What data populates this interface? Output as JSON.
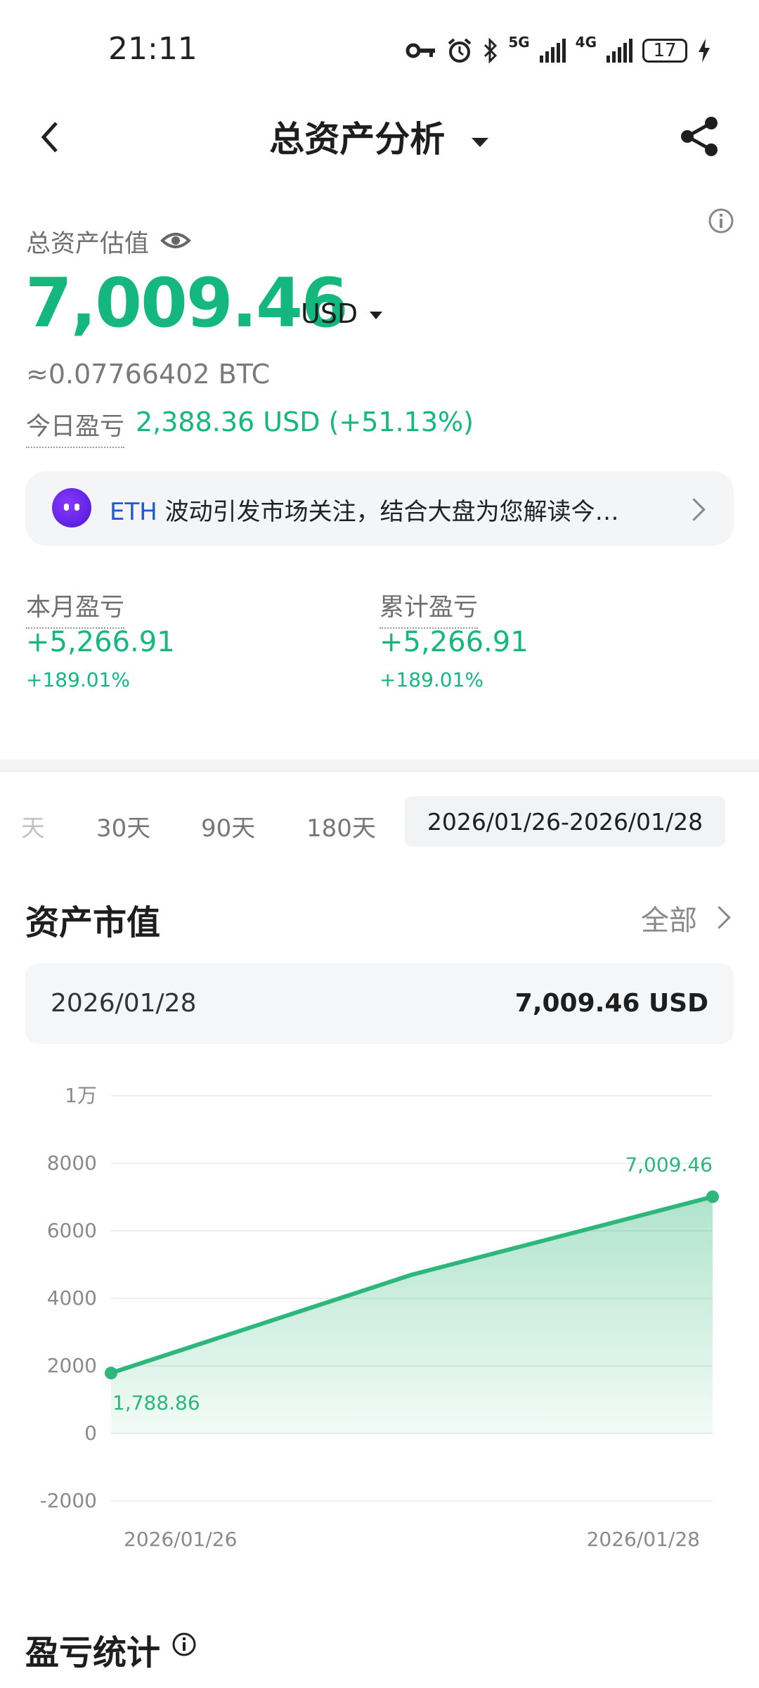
{
  "status_bar": {
    "time": "21:11",
    "net_5g": "5G",
    "net_4g": "4G",
    "battery": "17"
  },
  "header": {
    "title": "总资产分析"
  },
  "total": {
    "label": "总资产估值",
    "value": "7,009.46",
    "unit": "USD",
    "btc": "≈0.07766402 BTC",
    "today_label": "今日盈亏",
    "today_value": "2,388.36 USD (+51.13%)"
  },
  "banner": {
    "tag": "ETH",
    "text": " 波动引发市场关注，结合大盘为您解读今…"
  },
  "stats": {
    "month": {
      "label": "本月盈亏",
      "value": "+5,266.91",
      "pct": "+189.01%"
    },
    "cumulative": {
      "label": "累计盈亏",
      "value": "+5,266.91",
      "pct": "+189.01%"
    }
  },
  "tabs": {
    "partial": "天",
    "items": [
      "30天",
      "90天",
      "180天"
    ],
    "active": "2026/01/26-2026/01/28"
  },
  "market": {
    "title": "资产市值",
    "all_label": "全部",
    "selected_date": "2026/01/28",
    "selected_value": "7,009.46 USD"
  },
  "chart_data": {
    "type": "area",
    "x": [
      "2026/01/26",
      "2026/01/27",
      "2026/01/28"
    ],
    "values": [
      1788.86,
      4700,
      7009.46
    ],
    "point_labels": [
      "1,788.86",
      "",
      "7,009.46"
    ],
    "x_tick_labels": [
      "2026/01/26",
      "2026/01/28"
    ],
    "y_ticks": [
      10000,
      8000,
      6000,
      4000,
      2000,
      0,
      -2000
    ],
    "y_tick_labels": [
      "1万",
      "8000",
      "6000",
      "4000",
      "2000",
      "0",
      "-2000"
    ],
    "ylim": [
      -2000,
      10000
    ],
    "color": "#2db77b"
  },
  "pnl": {
    "title": "盈亏统计"
  }
}
